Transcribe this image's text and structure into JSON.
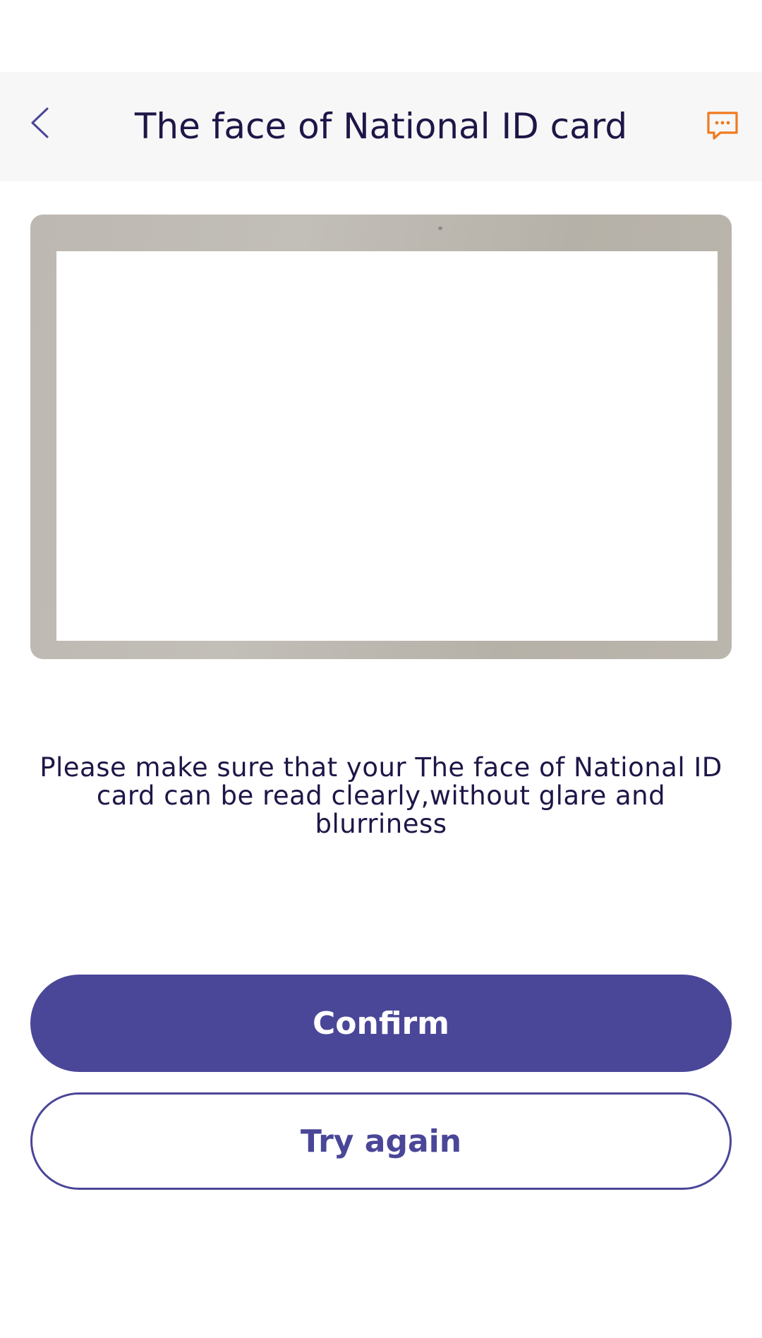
{
  "header": {
    "title": "The face of National ID card",
    "back_icon": "chevron-left-icon",
    "chat_icon": "chat-bubble-icon"
  },
  "instruction": "Please make sure that your The face of National ID card can be read clearly,without glare and blurriness",
  "actions": {
    "confirm_label": "Confirm",
    "retry_label": "Try again"
  },
  "colors": {
    "primary": "#4a4698",
    "title_text": "#1e1647",
    "chat_icon": "#f07a1e",
    "header_bg": "#f7f7f7"
  }
}
